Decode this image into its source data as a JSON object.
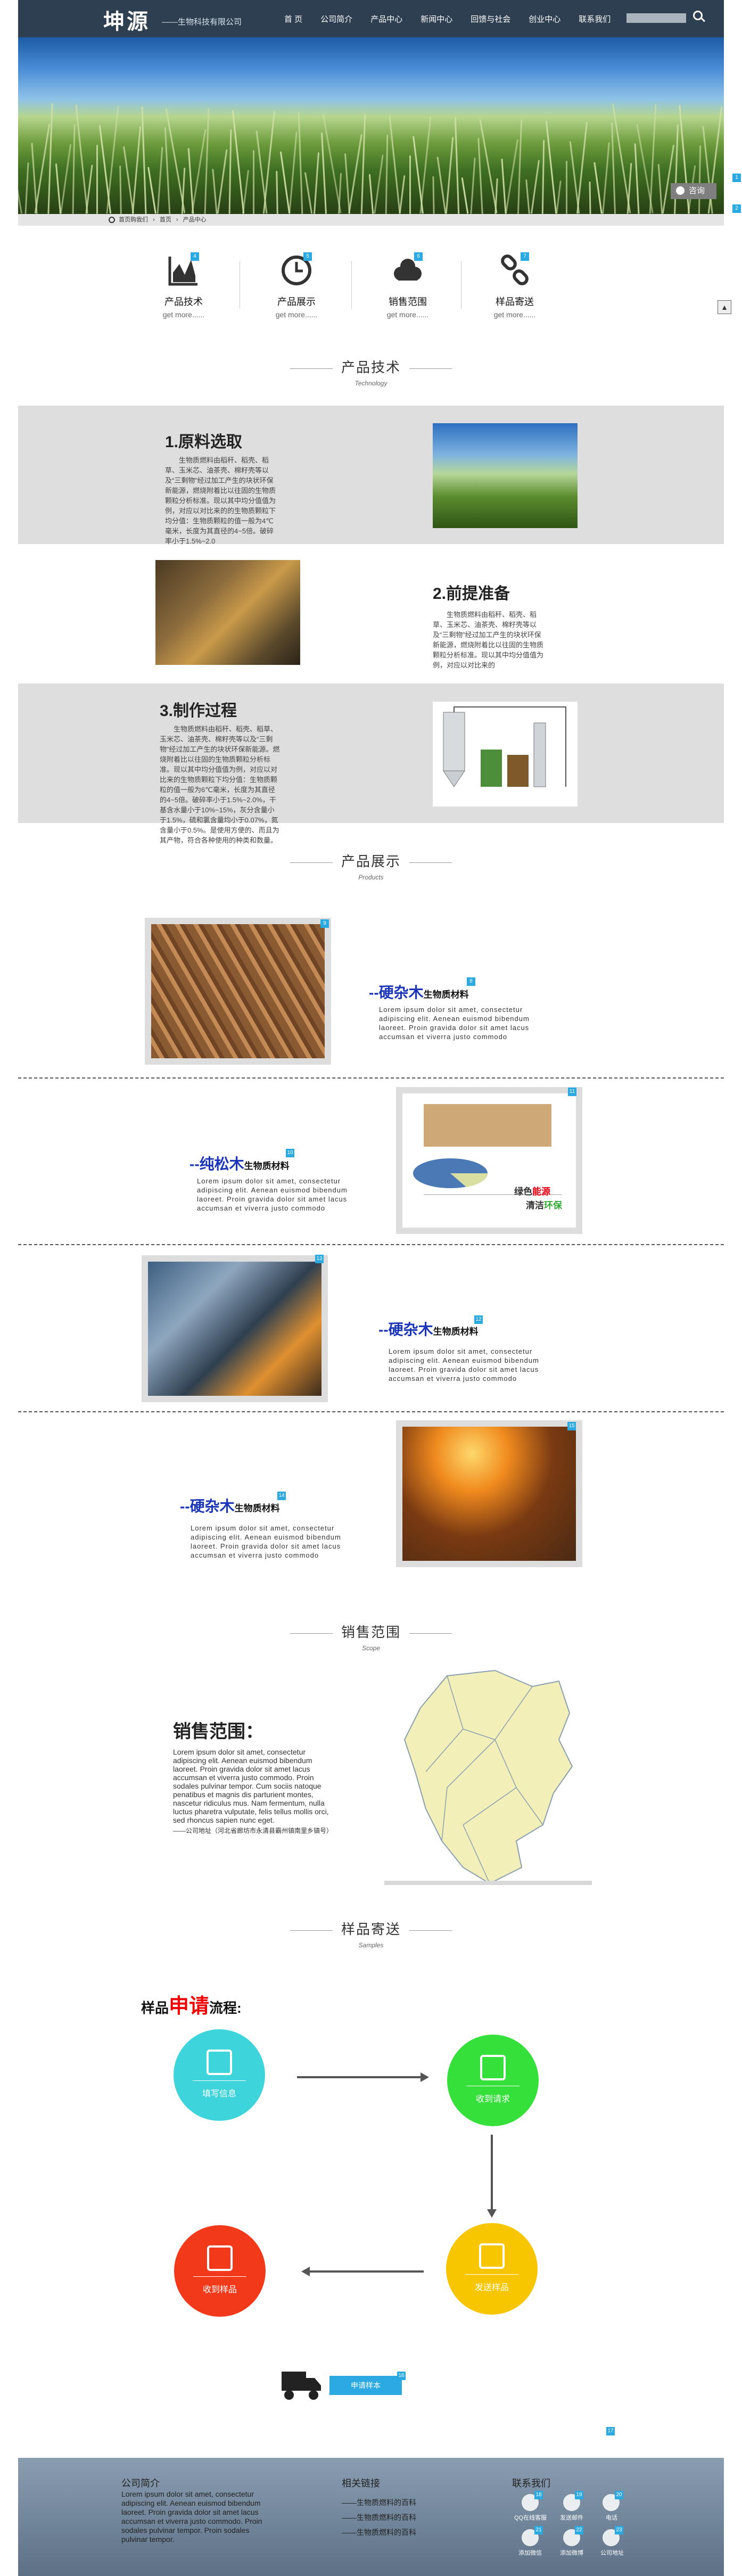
{
  "header": {
    "logo": "坤源",
    "logo_sub": "——生物科技有限公司",
    "nav": [
      "首 页",
      "公司简介",
      "产品中心",
      "新闻中心",
      "回馈与社会",
      "创业中心",
      "联系我们"
    ]
  },
  "hero": {
    "consult_label": "咨询",
    "badge_top": "1",
    "badge_bottom": "2"
  },
  "breadcrumb": {
    "home": "首页购我们",
    "sep": "›",
    "item1": "首页",
    "item2": "产品中心"
  },
  "quick_links": [
    {
      "title": "产品技术",
      "more": "get more......",
      "badge": "4"
    },
    {
      "title": "产品展示",
      "more": "get more......",
      "badge": "5"
    },
    {
      "title": "销售范围",
      "more": "get more......",
      "badge": "6"
    },
    {
      "title": "样品寄送",
      "more": "get more......",
      "badge": "7"
    }
  ],
  "sections": {
    "tech": {
      "title": "产品技术",
      "sub": "Technology"
    },
    "products": {
      "title": "产品展示",
      "sub": "Products"
    },
    "sales": {
      "title": "销售范围",
      "sub": "Scope"
    },
    "samples": {
      "title": "样品寄送",
      "sub": "Samples"
    }
  },
  "tech_steps": [
    {
      "title": "1.原料选取",
      "desc": "生物质燃料由稻秆、稻壳、稻草、玉米芯、油茶壳、棉籽壳等以及“三剩物”经过加工产生的块状环保新能源，燃烧附着比以往固的生物质颗粒分析标准。现以其中均分值值为例，对应以对比来的的生物质颗粒下均分值：生物质颗粒的值一般为4℃毫米，长度为其直径的4~5倍。破碎率小于1.5%~2.0"
    },
    {
      "title": "2.前提准备",
      "desc": "生物质燃料由稻秆、稻壳、稻草、玉米芯、油茶壳、棉籽壳等以及“三剩物”经过加工产生的块状环保新能源，燃烧附着比以往固的生物质颗粒分析标准。现以其中均分值值为例，对应以对比来的"
    },
    {
      "title": "3.制作过程",
      "desc": "生物质燃料由稻秆、稻壳、稻草、玉米芯、油茶壳、棉籽壳等以及“三剩物”经过加工产生的块状环保新能源。燃烧附着比以往固的生物质颗粒分析标准。现以其中均分值值为例，对应以对比来的生物质颗粒下均分值：生物质颗粒的值一般为6℃毫米，长度为其直径的4~5倍。破碎率小于1.5%~2.0%，干基含水量小于10%~15%，灰分含量小于1.5%，硫和氯含量均小于0.07%，氮含量小于0.5%。是使用方便的、而且为其产物，符合各种使用的种类和数量。"
    }
  ],
  "products": [
    {
      "name": "--硬杂木",
      "tag": "生物质材料",
      "badge": "8",
      "img_badge": "9",
      "desc": "Lorem ipsum dolor sit amet, consectetur adipiscing elit. Aenean euismod bibendum laoreet. Proin gravida dolor sit amet lacus accumsan et viverra justo commodo"
    },
    {
      "name": "--纯松木",
      "tag": "生物质材料",
      "badge": "10",
      "img_badge": "11",
      "desc": "Lorem ipsum dolor sit amet, consectetur adipiscing elit. Aenean euismod bibendum laoreet. Proin gravida dolor sit amet lacus accumsan et viverra justo commodo",
      "img_text1": "绿色",
      "img_text2": "能源",
      "img_text3": "清洁",
      "img_text4": "环保"
    },
    {
      "name": "--硬杂木",
      "tag": "生物质材料",
      "badge": "12",
      "img_badge": "13",
      "desc": "Lorem ipsum dolor sit amet, consectetur adipiscing elit. Aenean euismod bibendum laoreet. Proin gravida dolor sit amet lacus accumsan et viverra justo commodo"
    },
    {
      "name": "--硬杂木",
      "tag": "生物质材料",
      "badge": "14",
      "img_badge": "15",
      "desc": "Lorem ipsum dolor sit amet, consectetur adipiscing elit. Aenean euismod bibendum laoreet. Proin gravida dolor sit amet lacus accumsan et viverra justo commodo"
    }
  ],
  "sales": {
    "title": "销售范围：",
    "desc": "Lorem ipsum dolor sit amet, consectetur adipiscing elit. Aenean euismod bibendum laoreet. Proin gravida dolor sit amet lacus accumsan et viverra justo commodo. Proin sodales pulvinar tempor. Cum sociis natoque penatibus et magnis dis parturient montes, nascetur ridiculus mus. Nam fermentum, nulla luctus pharetra vulputate, felis tellus mollis orci, sed rhoncus sapien nunc eget.",
    "address": "——公司地址（河北省廊坊市永清县霸州镇南里乡镇号）"
  },
  "flow": {
    "title_prefix": "样品",
    "title_red": "申请",
    "title_suffix": "流程:",
    "steps": [
      "填写信息",
      "收到请求",
      "发送样品",
      "收到样品"
    ],
    "apply_button": "申请样本",
    "apply_badge": "16",
    "bottom_badge": "17",
    "colors": {
      "cyan": "#3dd4dc",
      "green": "#35e03a",
      "yellow": "#f7c600",
      "red": "#f23a1b"
    }
  },
  "footer": {
    "about_title": "公司简介",
    "about_text": "Lorem ipsum dolor sit amet, consectetur adipiscing elit. Aenean euismod bibendum laoreet. Proin gravida dolor sit amet lacus accumsan et viverra justo commodo. Proin sodales pulvinar tempor. Proin sodales pulvinar tempor.",
    "links_title": "相关链接",
    "links": [
      "——生物质燃料的百科",
      "——生物质燃料的百科",
      "——生物质燃料的百科"
    ],
    "contact_title": "联系我们",
    "contacts": [
      {
        "label": "QQ在线客服",
        "badge": "18"
      },
      {
        "label": "发送邮件",
        "badge": "19"
      },
      {
        "label": "电话",
        "badge": "20"
      },
      {
        "label": "添加微信",
        "badge": "21"
      },
      {
        "label": "添加微博",
        "badge": "22"
      },
      {
        "label": "公司地址",
        "badge": "23"
      }
    ]
  }
}
